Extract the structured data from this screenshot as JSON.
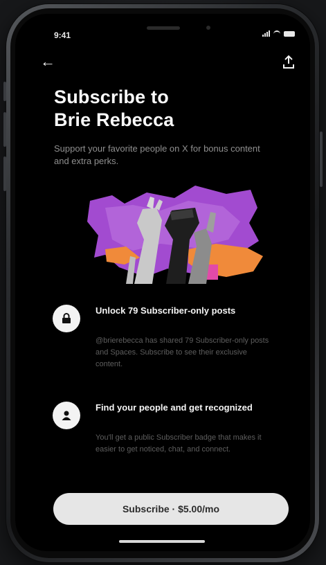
{
  "status_bar": {
    "time": "9:41"
  },
  "nav": {
    "back_icon": "back-arrow-icon",
    "share_icon": "share-icon"
  },
  "header": {
    "title_line1": "Subscribe to",
    "title_line2": "Brie Rebecca",
    "subtitle": "Support your favorite people on X for bonus content and extra perks."
  },
  "features": [
    {
      "icon": "lock-icon",
      "title": "Unlock 79 Subscriber-only posts",
      "description": "@brierebecca has shared 79 Subscriber-only posts and Spaces. Subscribe to see their exclusive content."
    },
    {
      "icon": "person-icon",
      "title": "Find your people and get recognized",
      "description": "You'll get a public Subscriber badge that makes it easier to get noticed, chat, and connect."
    }
  ],
  "cta": {
    "subscribe_label": "Subscribe · $5.00/mo"
  },
  "colors": {
    "background": "#000000",
    "button": "#e6e6e6",
    "purple": "#a24bd0",
    "orange": "#f08a3a",
    "pink": "#e24aa8"
  }
}
